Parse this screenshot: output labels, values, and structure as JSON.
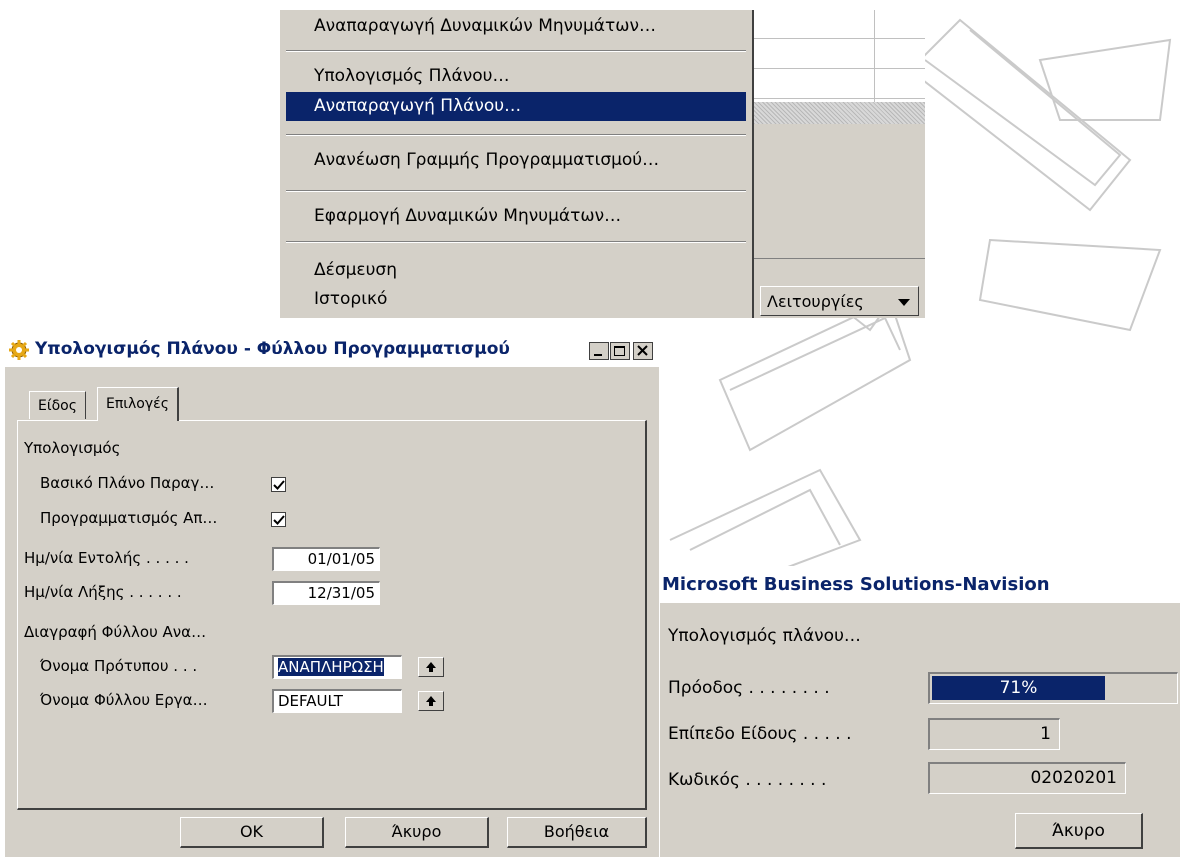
{
  "menu": {
    "items": [
      {
        "label": "Αναπαραγωγή Δυναμικών Μηνυμάτων…"
      },
      {
        "label": "Υπολογισμός Πλάνου…"
      },
      {
        "label": "Αναπαραγωγή Πλάνου…",
        "selected": true
      },
      {
        "label": "Ανανέωση Γραμμής Προγραμματισμού…"
      },
      {
        "label": "Εφαρμογή Δυναμικών Μηνυμάτων…"
      },
      {
        "label": "Δέσμευση"
      },
      {
        "label": "Ιστορικό"
      }
    ],
    "functions_button": "Λειτουργίες"
  },
  "calc_dialog": {
    "title": "Υπολογισμός Πλάνου - Φύλλου Προγραμματισμού",
    "tabs": [
      "Είδος",
      "Επιλογές"
    ],
    "active_tab": "Επιλογές",
    "section_calc": "Υπολογισμός",
    "basic_plan_label": "Βασικό Πλάνο Παραγ…",
    "basic_plan_checked": true,
    "scheduling_label": "Προγραμματισμός Απ…",
    "scheduling_checked": true,
    "order_date_label": "Ημ/νία Εντολής . . . . .",
    "order_date_value": "01/01/05",
    "end_date_label": "Ημ/νία Λήξης . . . . . .",
    "end_date_value": "12/31/05",
    "section_delete": "Διαγραφή Φύλλου Ανα…",
    "template_name_label": "Όνομα Πρότυπου . . .",
    "template_name_value": "ΑΝΑΠΛΗΡΩΣΗ",
    "sheet_name_label": "Όνομα Φύλλου Εργα…",
    "sheet_name_value": "DEFAULT",
    "ok_label": "OK",
    "cancel_label": "Άκυρο",
    "help_label": "Βοήθεια"
  },
  "progress_dialog": {
    "title": "Microsoft Business Solutions-Navision",
    "message": "Υπολογισμός πλάνου…",
    "progress_label": "Πρόοδος . . . . . . . .",
    "progress_text": "71%",
    "progress_value": 0.71,
    "level_label": "Επίπεδο Είδους . . . . .",
    "level_value": "1",
    "code_label": "Κωδικός . . . . . . . .",
    "code_value": "02020201",
    "cancel_label": "Άκυρο"
  },
  "colors": {
    "selection": "#0a246a",
    "face": "#d4d0c8",
    "title_text": "#0a246a"
  }
}
